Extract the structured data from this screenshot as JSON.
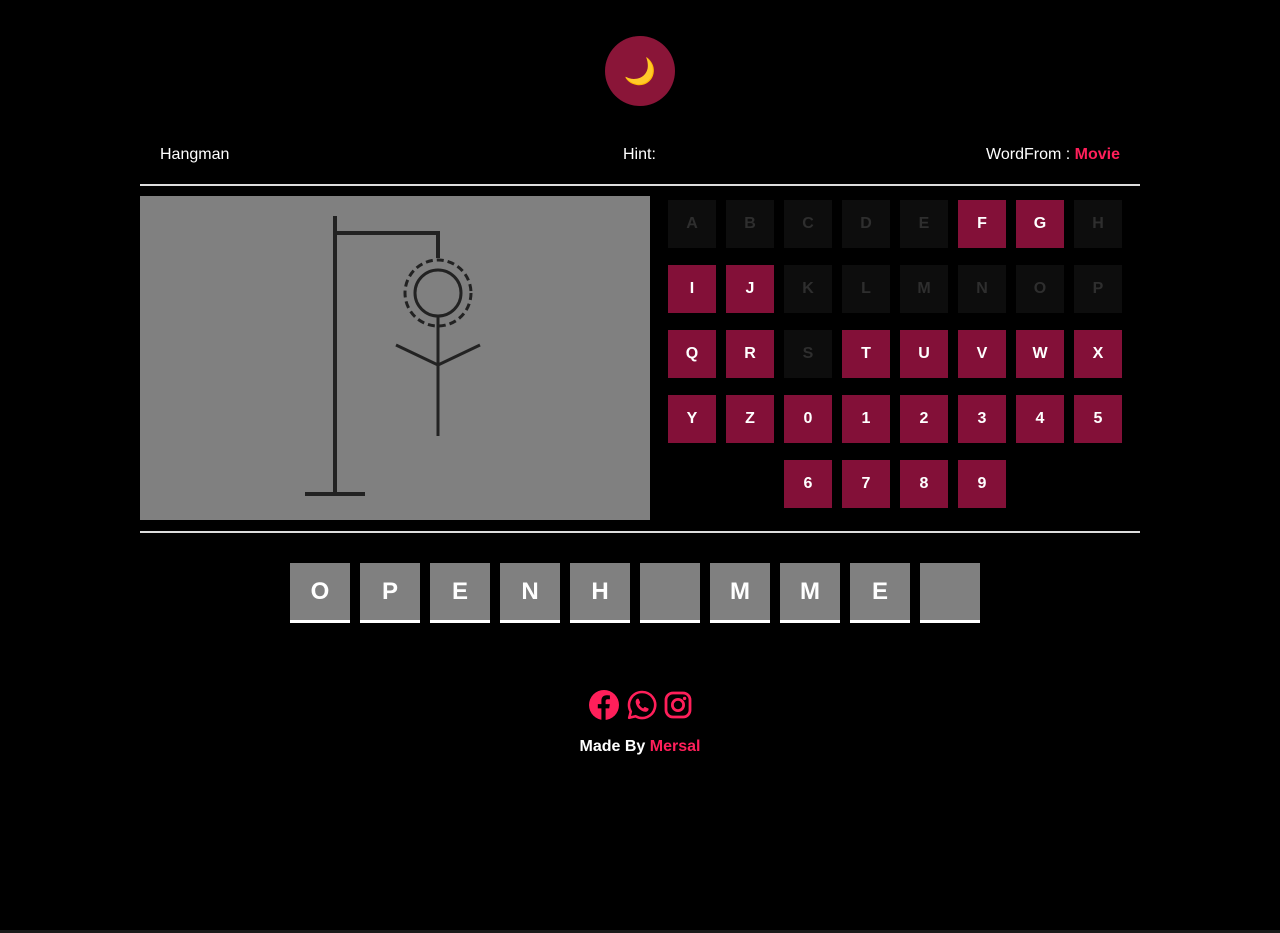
{
  "theme_toggle": {
    "icon": "crescent-moon-icon",
    "glyph": "🌙"
  },
  "header": {
    "title": "Hangman",
    "hint_label": "Hint:",
    "hint_value": "",
    "wordfrom_label": "WordFrom :",
    "category": "Movie"
  },
  "colors": {
    "background": "#000000",
    "accent": "#ff1f5a",
    "key_available": "#831038",
    "key_used": "#0d0d0d",
    "panel": "#808080",
    "toggle": "#8a1538"
  },
  "keyboard": {
    "keys": [
      {
        "label": "A",
        "state": "used"
      },
      {
        "label": "B",
        "state": "used"
      },
      {
        "label": "C",
        "state": "used"
      },
      {
        "label": "D",
        "state": "used"
      },
      {
        "label": "E",
        "state": "used"
      },
      {
        "label": "F",
        "state": "available"
      },
      {
        "label": "G",
        "state": "available"
      },
      {
        "label": "H",
        "state": "used"
      },
      {
        "label": "I",
        "state": "available"
      },
      {
        "label": "J",
        "state": "available"
      },
      {
        "label": "K",
        "state": "used"
      },
      {
        "label": "L",
        "state": "used"
      },
      {
        "label": "M",
        "state": "used"
      },
      {
        "label": "N",
        "state": "used"
      },
      {
        "label": "O",
        "state": "used"
      },
      {
        "label": "P",
        "state": "used"
      },
      {
        "label": "Q",
        "state": "available"
      },
      {
        "label": "R",
        "state": "available"
      },
      {
        "label": "S",
        "state": "used"
      },
      {
        "label": "T",
        "state": "available"
      },
      {
        "label": "U",
        "state": "available"
      },
      {
        "label": "V",
        "state": "available"
      },
      {
        "label": "W",
        "state": "available"
      },
      {
        "label": "X",
        "state": "available"
      },
      {
        "label": "Y",
        "state": "available"
      },
      {
        "label": "Z",
        "state": "available"
      },
      {
        "label": "0",
        "state": "available"
      },
      {
        "label": "1",
        "state": "available"
      },
      {
        "label": "2",
        "state": "available"
      },
      {
        "label": "3",
        "state": "available"
      },
      {
        "label": "4",
        "state": "available"
      },
      {
        "label": "5",
        "state": "available"
      },
      {
        "label": "6",
        "state": "available"
      },
      {
        "label": "7",
        "state": "available"
      },
      {
        "label": "8",
        "state": "available"
      },
      {
        "label": "9",
        "state": "available"
      }
    ]
  },
  "word": {
    "letters": [
      "O",
      "P",
      "E",
      "N",
      "H",
      "",
      "M",
      "M",
      "E",
      ""
    ]
  },
  "socials": [
    {
      "name": "facebook-icon"
    },
    {
      "name": "whatsapp-icon"
    },
    {
      "name": "instagram-icon"
    }
  ],
  "footer": {
    "made_by_label": "Made By",
    "author": "Mersal"
  }
}
